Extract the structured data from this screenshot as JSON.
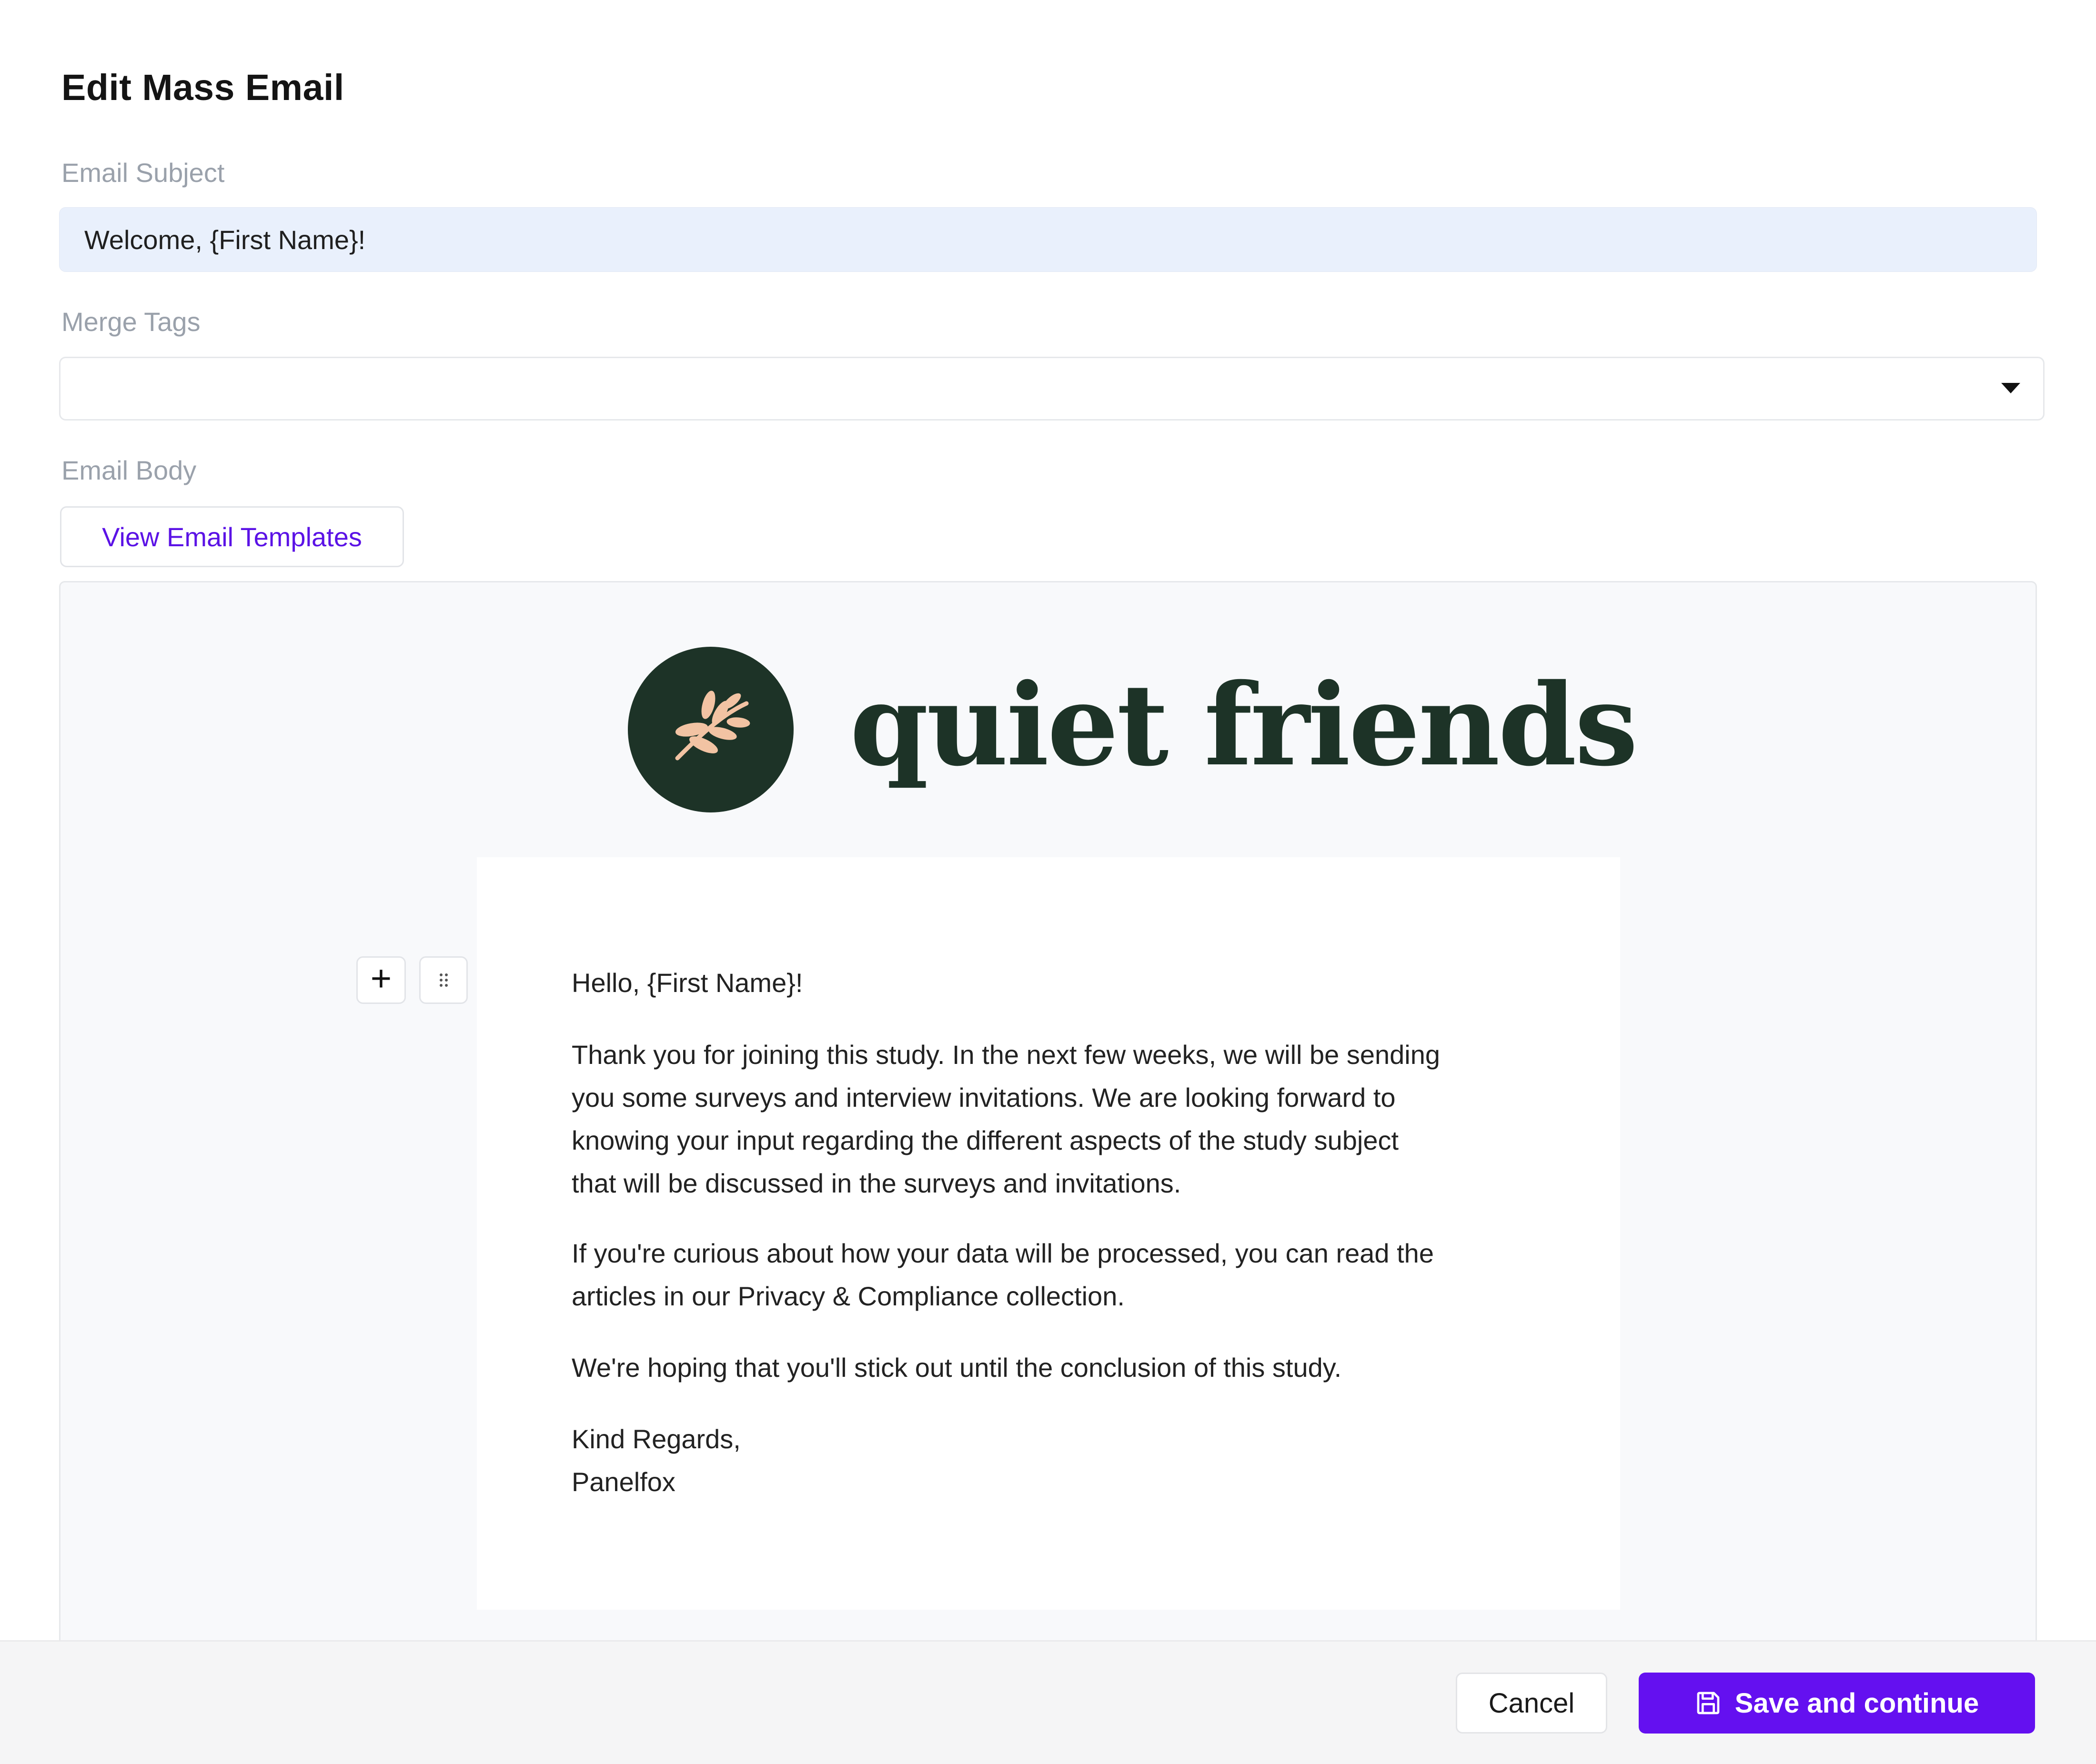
{
  "modal": {
    "title": "Edit Mass Email"
  },
  "subject": {
    "label": "Email Subject",
    "value": "Welcome, {First Name}!"
  },
  "merge_tags": {
    "label": "Merge Tags",
    "selected": ""
  },
  "body": {
    "label": "Email Body",
    "templates_button": "View Email Templates"
  },
  "email": {
    "brand_name": "quiet friends",
    "greeting": "Hello, {First Name}!",
    "paragraph_1_lines": [
      "Thank you for joining this study. In the next few weeks, we will be sending",
      "you some surveys and interview invitations. We are looking forward to",
      "knowing your input regarding the different aspects of the study subject",
      "that will be discussed in the surveys and invitations."
    ],
    "paragraph_2_lines": [
      "If you're curious about how your data will be processed, you can read the",
      "articles in our Privacy & Compliance collection."
    ],
    "paragraph_3": "We're hoping that you'll stick out until the conclusion of this study.",
    "signoff": "Kind Regards,",
    "signature": "Panelfox"
  },
  "footer": {
    "cancel_label": "Cancel",
    "save_label": "Save and continue"
  },
  "colors": {
    "accent": "#6410f0",
    "brand_dark": "#1d3327",
    "brand_leaf": "#f2c3a3",
    "subject_bg": "#e9f0fc"
  },
  "icons": {
    "merge_caret": "caret-down-icon",
    "add_block": "plus-icon",
    "drag_block": "drag-handle-icon",
    "save": "floppy-disk-icon",
    "brand_mark": "leaf-icon"
  }
}
